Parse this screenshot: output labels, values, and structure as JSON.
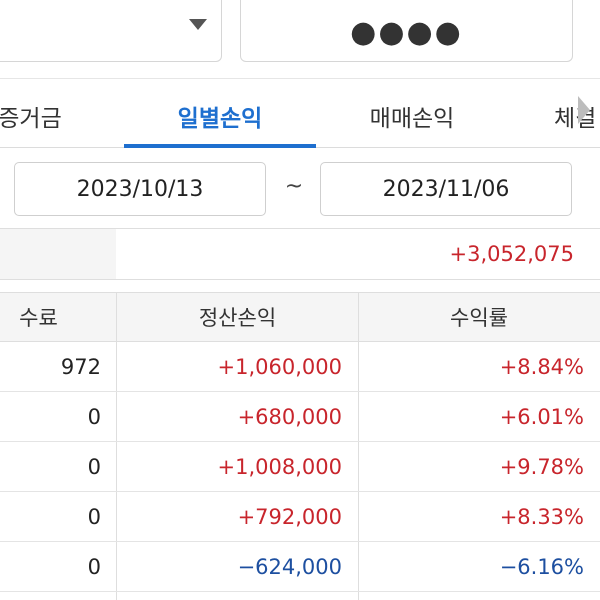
{
  "controls": {
    "password_mask": "●●●●"
  },
  "tabs": [
    {
      "label": "증거금",
      "active": false
    },
    {
      "label": "일별손익",
      "active": true
    },
    {
      "label": "매매손익",
      "active": false
    },
    {
      "label": "체결",
      "active": false
    }
  ],
  "date_range": {
    "start": "2023/10/13",
    "separator": "~",
    "end": "2023/11/06"
  },
  "summary": {
    "total_value": "+3,052,075"
  },
  "table": {
    "headers": {
      "fee": "수료",
      "settled_pnl": "정산손익",
      "return_rate": "수익률"
    },
    "rows": [
      {
        "fee": "972",
        "settled_pnl": "+1,060,000",
        "return_rate": "+8.84%",
        "sign": "pos"
      },
      {
        "fee": "0",
        "settled_pnl": "+680,000",
        "return_rate": "+6.01%",
        "sign": "pos"
      },
      {
        "fee": "0",
        "settled_pnl": "+1,008,000",
        "return_rate": "+9.78%",
        "sign": "pos"
      },
      {
        "fee": "0",
        "settled_pnl": "+792,000",
        "return_rate": "+8.33%",
        "sign": "pos"
      },
      {
        "fee": "0",
        "settled_pnl": "−624,000",
        "return_rate": "−6.16%",
        "sign": "neg"
      }
    ]
  },
  "colors": {
    "accent": "#1e6fcf",
    "positive": "#c8252c",
    "negative": "#1d4fa0"
  }
}
